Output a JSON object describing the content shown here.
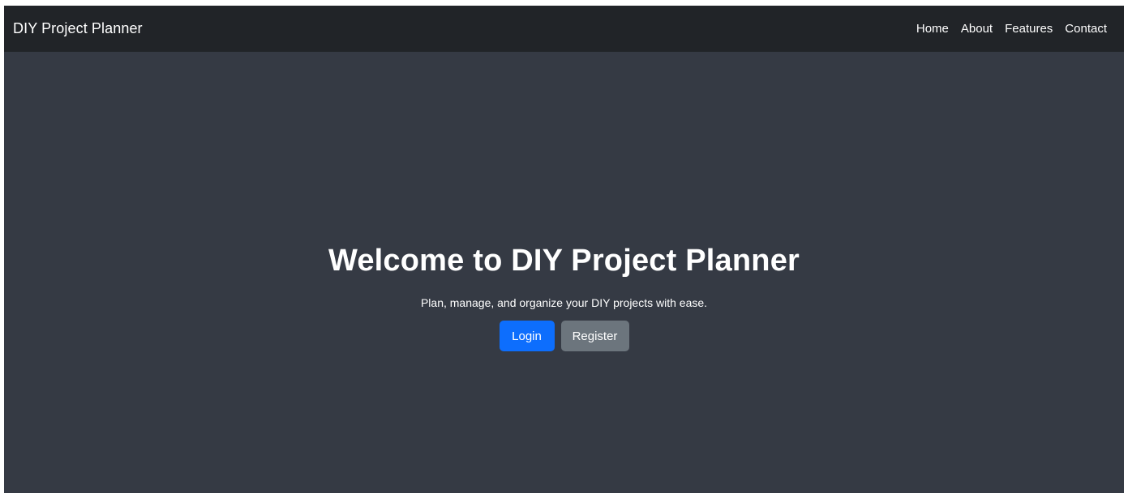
{
  "navbar": {
    "brand": "DIY Project Planner",
    "links": [
      {
        "label": "Home"
      },
      {
        "label": "About"
      },
      {
        "label": "Features"
      },
      {
        "label": "Contact"
      }
    ]
  },
  "hero": {
    "title": "Welcome to DIY Project Planner",
    "subtitle": "Plan, manage, and organize your DIY projects with ease.",
    "buttons": {
      "login": "Login",
      "register": "Register"
    }
  },
  "colors": {
    "page_background": "#353a44",
    "navbar_background": "#212428",
    "primary_button": "#0d6efd",
    "secondary_button": "#6c757d",
    "text": "#ffffff"
  }
}
